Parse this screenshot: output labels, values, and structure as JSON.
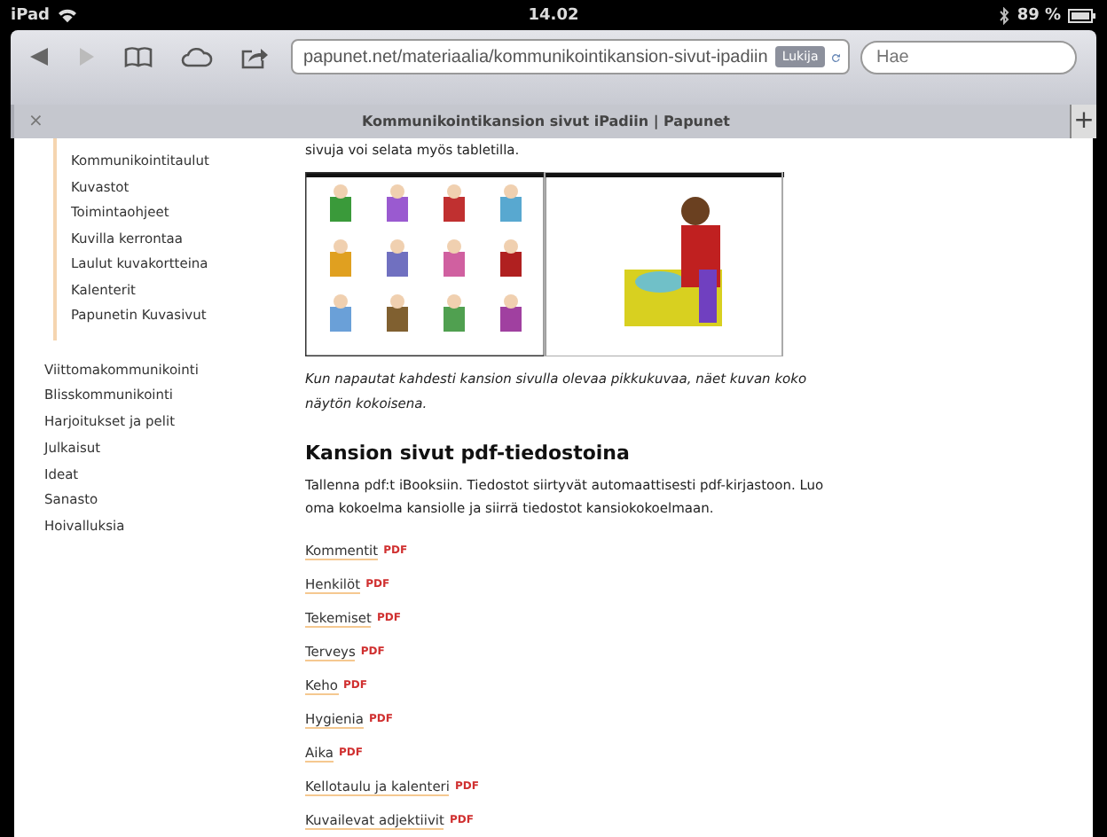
{
  "status_bar": {
    "device": "iPad",
    "time": "14.02",
    "battery": "89 %"
  },
  "toolbar": {
    "url": "papunet.net/materiaalia/kommunikointikansion-sivut-ipadiin",
    "reader_button": "Lukija",
    "search": {
      "placeholder": "Hae"
    }
  },
  "tab": {
    "close": "×",
    "title": "Kommunikointikansion sivut iPadiin | Papunet",
    "new_tab": "+"
  },
  "sidebar": {
    "subitems": [
      "Kommunikointitaulut",
      "Kuvastot",
      "Toimintaohjeet",
      "Kuvilla kerrontaa",
      "Laulut kuvakortteina",
      "Kalenterit",
      "Papunetin Kuvasivut"
    ],
    "items": [
      "Viittomakommunikointi",
      "Blisskommunikointi",
      "Harjoitukset ja pelit",
      "Julkaisut",
      "Ideat",
      "Sanasto",
      "Hoivalluksia"
    ]
  },
  "content": {
    "intro": "sivuja voi selata myös tabletilla.",
    "caption": "Kun napautat kahdesti kansion sivulla olevaa pikkukuvaa, näet kuvan koko näytön kokoisena.",
    "heading": "Kansion sivut pdf-tiedostoina",
    "text": "Tallenna pdf:t iBooksiin. Tiedostot siirtyvät automaattisesti pdf-kirjastoon. Luo oma kokoelma kansiolle ja siirrä tiedostot kansiokokoelmaan.",
    "links": [
      {
        "label": "Kommentit",
        "badge": "PDF"
      },
      {
        "label": "Henkilöt",
        "badge": "PDF"
      },
      {
        "label": "Tekemiset",
        "badge": "PDF"
      },
      {
        "label": "Terveys",
        "badge": "PDF"
      },
      {
        "label": "Keho",
        "badge": "PDF"
      },
      {
        "label": "Hygienia",
        "badge": "PDF"
      },
      {
        "label": "Aika",
        "badge": "PDF"
      },
      {
        "label": "Kellotaulu ja kalenteri",
        "badge": "PDF"
      },
      {
        "label": "Kuvailevat adjektiivit",
        "badge": "PDF"
      }
    ]
  }
}
